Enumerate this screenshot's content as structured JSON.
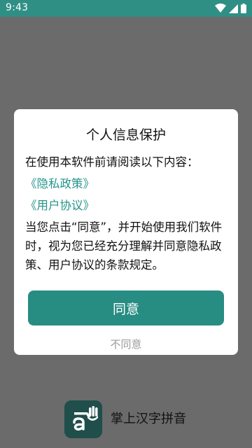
{
  "status_bar": {
    "time": "9:43",
    "icons": [
      "wifi-icon",
      "signal-icon",
      "battery-icon"
    ]
  },
  "dialog": {
    "title": "个人信息保护",
    "intro": "在使用本软件前请阅读以下内容：",
    "privacy_link": "《隐私政策》",
    "user_agreement_link": "《用户协议》",
    "notice": "当您点击“同意”，并开始使用我们软件时，视为您已经充分理解并同意隐私政策、用户协议的条款规定。",
    "agree_label": "同意",
    "disagree_label": "不同意"
  },
  "app": {
    "name": "掌上汉字拼音",
    "logo": "app-logo-icon"
  },
  "colors": {
    "status_bar": "#2f8f85",
    "backdrop": "#6b6b6b",
    "accent": "#278c82",
    "link": "#24948a",
    "muted_text": "#9b9b9b"
  }
}
